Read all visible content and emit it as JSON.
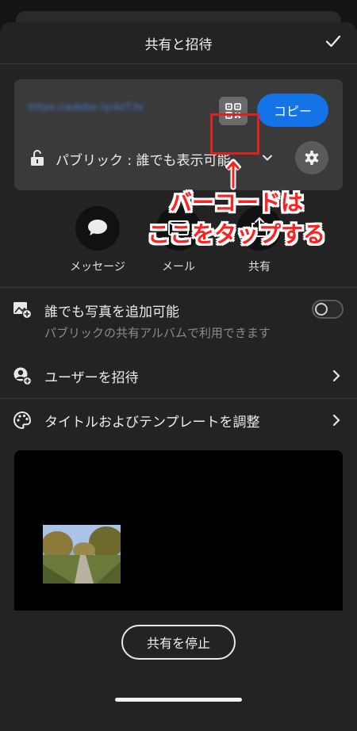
{
  "header": {
    "title": "共有と招待",
    "done_icon": "checkmark-icon"
  },
  "link_card": {
    "url": "https://adobe.ly/4zT3s",
    "copy_label": "コピー",
    "visibility_label": "パブリック : 誰でも表示可能",
    "qr_icon": "qr-code-icon",
    "gear_icon": "gear-icon"
  },
  "annotation": {
    "line1": "バーコードは",
    "line2": "ここをタップする",
    "color": "#ff2020"
  },
  "share_options": [
    {
      "label": "メッセージ",
      "icon": "message-icon"
    },
    {
      "label": "メール",
      "icon": "mail-icon"
    },
    {
      "label": "共有",
      "icon": "share-icon"
    }
  ],
  "settings": {
    "contribute": {
      "label": "誰でも写真を追加可能",
      "sublabel": "パブリックの共有アルバムで利用できます",
      "enabled": false
    },
    "invite": {
      "label": "ユーザーを招待"
    },
    "theme": {
      "label": "タイトルおよびテンプレートを調整"
    }
  },
  "stop_button": {
    "label": "共有を停止"
  },
  "colors": {
    "accent": "#1473e6",
    "background": "#232323",
    "card": "#3a3a3a"
  }
}
